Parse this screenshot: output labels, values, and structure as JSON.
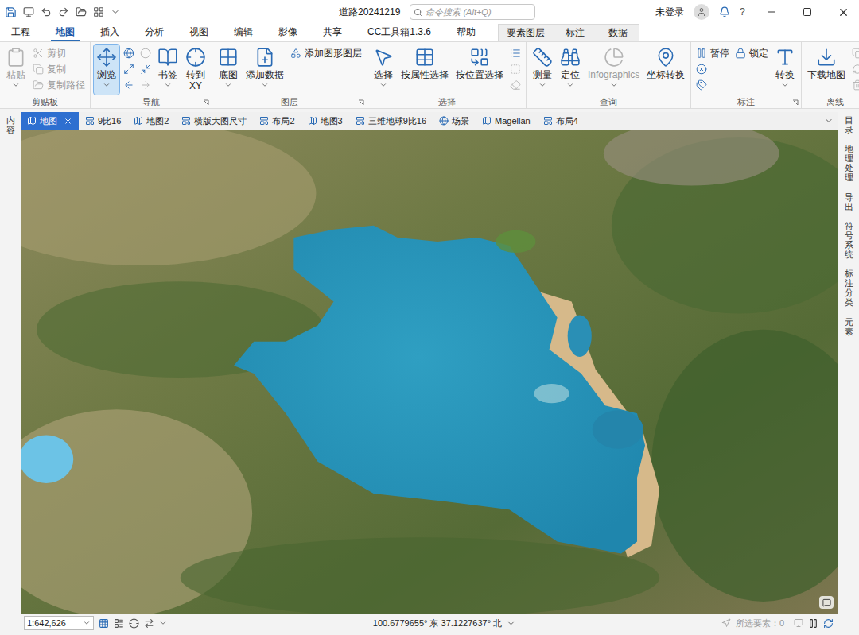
{
  "window": {
    "title": "道路20241219",
    "search_placeholder": "命令搜索 (Alt+Q)",
    "user": "未登录",
    "help": "?"
  },
  "ribbon_tabs": [
    {
      "label": "工程",
      "selected": false
    },
    {
      "label": "地图",
      "selected": true
    },
    {
      "label": "插入",
      "selected": false
    },
    {
      "label": "分析",
      "selected": false
    },
    {
      "label": "视图",
      "selected": false
    },
    {
      "label": "编辑",
      "selected": false
    },
    {
      "label": "影像",
      "selected": false
    },
    {
      "label": "共享",
      "selected": false
    },
    {
      "label": "CC工具箱1.3.6",
      "selected": false
    },
    {
      "label": "帮助",
      "selected": false
    }
  ],
  "contextual_tabs": {
    "group": "要素图层",
    "tabs": [
      {
        "label": "标注",
        "selected": false
      },
      {
        "label": "数据",
        "selected": false
      }
    ]
  },
  "ribbon_groups": [
    {
      "label": "剪贴板",
      "launcher": false,
      "items": [
        {
          "label": "粘贴",
          "kind": "large",
          "disabled": true,
          "selected": false,
          "menu": true
        },
        {
          "label": "剪切",
          "kind": "small",
          "disabled": true,
          "selected": false
        },
        {
          "label": "复制",
          "kind": "small",
          "disabled": true,
          "selected": false
        },
        {
          "label": "复制路径",
          "kind": "small",
          "disabled": true,
          "selected": false
        }
      ]
    },
    {
      "label": "导航",
      "launcher": true,
      "items": [
        {
          "label": "浏览",
          "kind": "large",
          "disabled": false,
          "selected": true,
          "menu": true
        },
        {
          "kind": "icon",
          "disabled": false,
          "selected": false
        },
        {
          "kind": "icon",
          "disabled": false,
          "selected": false
        },
        {
          "kind": "icon",
          "disabled": false,
          "selected": false
        },
        {
          "kind": "icon",
          "disabled": true,
          "selected": false
        },
        {
          "kind": "icon",
          "disabled": false,
          "selected": false
        },
        {
          "kind": "icon",
          "disabled": true,
          "selected": false
        },
        {
          "label": "书签",
          "kind": "large",
          "disabled": false,
          "selected": false,
          "menu": true
        },
        {
          "label": "转到",
          "sublabel": "XY",
          "kind": "large",
          "disabled": false,
          "selected": false,
          "menu": false
        }
      ]
    },
    {
      "label": "图层",
      "launcher": true,
      "items": [
        {
          "label": "底图",
          "kind": "large",
          "disabled": false,
          "selected": false,
          "menu": true
        },
        {
          "label": "添加数据",
          "kind": "large",
          "disabled": false,
          "selected": false,
          "menu": true
        },
        {
          "label": "添加图形图层",
          "kind": "small",
          "disabled": false,
          "selected": false
        }
      ]
    },
    {
      "label": "选择",
      "launcher": false,
      "items": [
        {
          "label": "选择",
          "kind": "large",
          "disabled": false,
          "selected": false,
          "menu": true
        },
        {
          "label": "按属性选择",
          "kind": "large",
          "disabled": false,
          "selected": false,
          "menu": false
        },
        {
          "label": "按位置选择",
          "kind": "large",
          "disabled": false,
          "selected": false,
          "menu": false
        },
        {
          "kind": "icon",
          "disabled": false,
          "selected": false
        },
        {
          "kind": "icon",
          "disabled": true,
          "selected": false
        },
        {
          "kind": "icon",
          "disabled": true,
          "selected": false
        }
      ]
    },
    {
      "label": "查询",
      "launcher": false,
      "items": [
        {
          "label": "测量",
          "kind": "large",
          "disabled": false,
          "selected": false,
          "menu": true
        },
        {
          "label": "定位",
          "kind": "large",
          "disabled": false,
          "selected": false,
          "menu": true
        },
        {
          "label": "Infographics",
          "kind": "large",
          "disabled": true,
          "selected": false,
          "menu": true
        },
        {
          "label": "坐标转换",
          "kind": "large",
          "disabled": false,
          "selected": false,
          "menu": false
        }
      ]
    },
    {
      "label": "标注",
      "launcher": true,
      "items": [
        {
          "label": "暂停",
          "kind": "small",
          "disabled": false,
          "selected": false
        },
        {
          "kind": "icon",
          "disabled": false,
          "selected": false
        },
        {
          "kind": "icon",
          "disabled": false,
          "selected": false
        },
        {
          "label": "锁定",
          "kind": "small",
          "disabled": false,
          "selected": false
        },
        {
          "label": "转换",
          "kind": "large",
          "disabled": false,
          "selected": false,
          "menu": true
        }
      ]
    },
    {
      "label": "离线",
      "launcher": true,
      "items": [
        {
          "label": "下载地图",
          "kind": "large",
          "disabled": false,
          "selected": false,
          "menu": false
        },
        {
          "kind": "icon",
          "disabled": true,
          "selected": false
        },
        {
          "kind": "icon",
          "disabled": true,
          "selected": false
        },
        {
          "kind": "icon",
          "disabled": true,
          "selected": false
        }
      ]
    }
  ],
  "doc_tabs": [
    {
      "label": "地图",
      "kind": "map",
      "selected": true
    },
    {
      "label": "9比16",
      "kind": "layout",
      "selected": false
    },
    {
      "label": "地图2",
      "kind": "map",
      "selected": false
    },
    {
      "label": "横版大图尺寸",
      "kind": "layout",
      "selected": false
    },
    {
      "label": "布局2",
      "kind": "layout",
      "selected": false
    },
    {
      "label": "地图3",
      "kind": "map",
      "selected": false
    },
    {
      "label": "三维地球9比16",
      "kind": "layout",
      "selected": false
    },
    {
      "label": "场景",
      "kind": "scene",
      "selected": false
    },
    {
      "label": "Magellan",
      "kind": "map",
      "selected": false
    },
    {
      "label": "布局4",
      "kind": "layout",
      "selected": false
    }
  ],
  "left_panes": [
    "内容"
  ],
  "right_panes": [
    "目录",
    "地理处理",
    "导出",
    "符号系统",
    "标注分类",
    "元素"
  ],
  "status_bar": {
    "scale": "1:642,626",
    "coordinates": "100.6779655° 东 37.1227637° 北",
    "selected_features": "所选要素：0",
    "selected_features_disabled": true
  }
}
